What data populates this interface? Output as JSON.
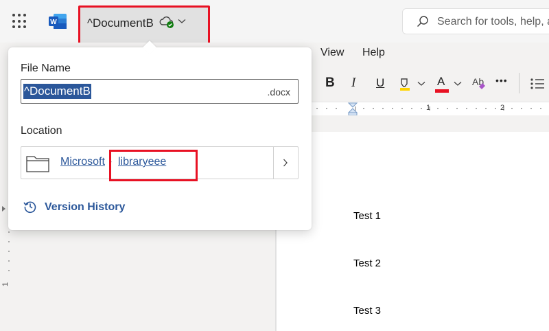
{
  "titlebar": {
    "doc_title": "^DocumentB",
    "search_placeholder": "Search for tools, help, a"
  },
  "menu": {
    "view": "View",
    "help": "Help"
  },
  "ribbon": {
    "bold": "B",
    "italic": "I",
    "underline": "U",
    "font_color": "A",
    "more": "•••"
  },
  "ruler": {
    "tick1": "1",
    "tick2": "2"
  },
  "document": {
    "lines": [
      "Test 1",
      "Test 2",
      "Test 3"
    ]
  },
  "vruler": {
    "tick1": "1"
  },
  "popup": {
    "file_name_label": "File Name",
    "file_name_value": "^DocumentB",
    "extension": ".docx",
    "location_label": "Location",
    "crumb_1": "Microsoft",
    "crumb_2": "libraryeee",
    "version_history": "Version History"
  },
  "colors": {
    "accent": "#2b579a",
    "annotation": "#e81123"
  }
}
